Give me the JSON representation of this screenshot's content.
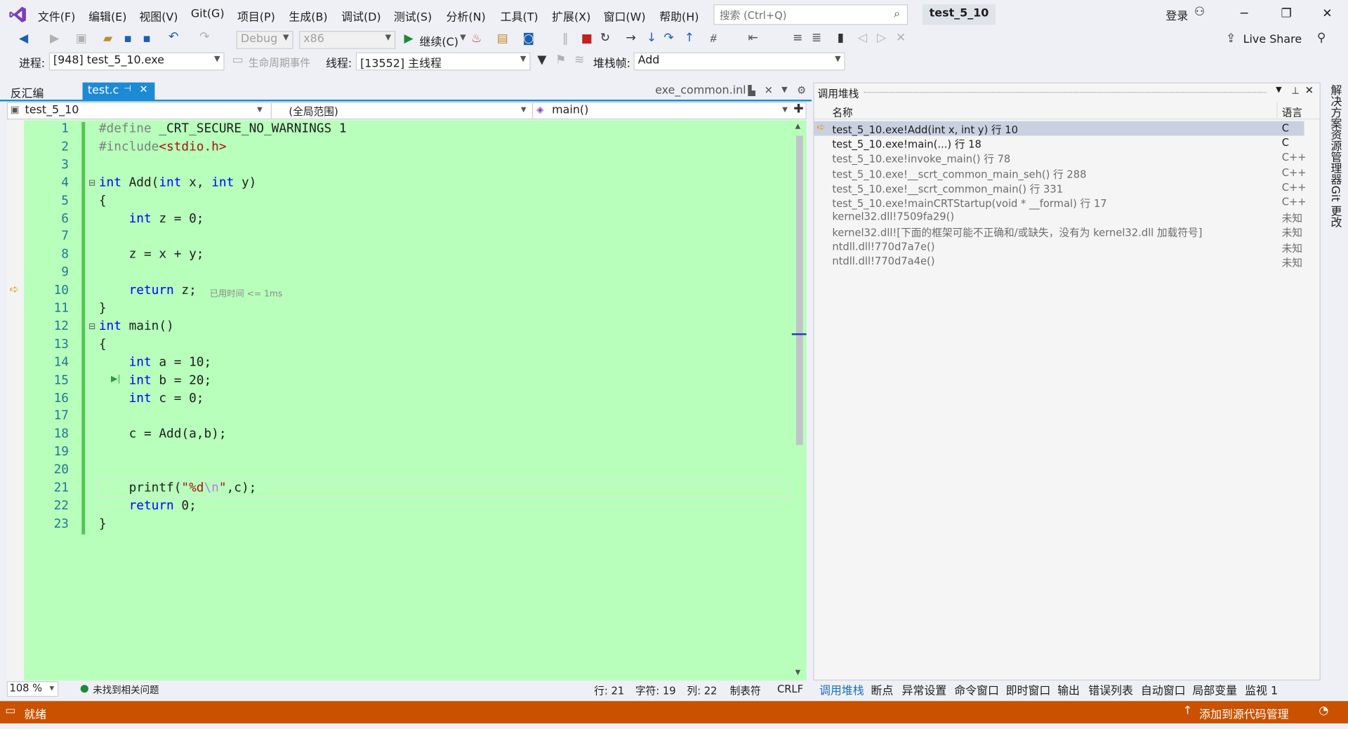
{
  "menu": [
    "文件(F)",
    "编辑(E)",
    "视图(V)",
    "Git(G)",
    "项目(P)",
    "生成(B)",
    "调试(D)",
    "测试(S)",
    "分析(N)",
    "工具(T)",
    "扩展(X)",
    "窗口(W)",
    "帮助(H)"
  ],
  "search_placeholder": "搜索 (Ctrl+Q)",
  "project_name": "test_5_10",
  "login": "登录",
  "live_share": "Live Share",
  "toolbar": {
    "config": "Debug",
    "platform": "x86",
    "continue": "继续(C)"
  },
  "debug_location": {
    "process_label": "进程:",
    "process_value": "[948] test_5_10.exe",
    "lifecycle": "生命周期事件",
    "thread_label": "线程:",
    "thread_value": "[13552] 主线程",
    "stackframe_label": "堆栈帧:",
    "stackframe_value": "Add"
  },
  "editor_tabs": {
    "disasm": "反汇编",
    "active": "test.c",
    "pinned": "exe_common.inl"
  },
  "nav": {
    "project": "test_5_10",
    "scope": "(全局范围)",
    "member": "main()"
  },
  "code_lines": [
    {
      "n": "1",
      "html": "<span class='pp'>#define</span> _CRT_SECURE_NO_WARNINGS 1"
    },
    {
      "n": "2",
      "html": "<span class='pp'>#include</span><span class='str'>&lt;stdio.h&gt;</span>"
    },
    {
      "n": "3",
      "html": ""
    },
    {
      "n": "4",
      "html": "<span class='kw'>int</span> Add(<span class='kw'>int</span> x, <span class='kw'>int</span> y)"
    },
    {
      "n": "5",
      "html": "{"
    },
    {
      "n": "6",
      "html": "    <span class='kw'>int</span> z = 0;"
    },
    {
      "n": "7",
      "html": ""
    },
    {
      "n": "8",
      "html": "    z = x + y;"
    },
    {
      "n": "9",
      "html": ""
    },
    {
      "n": "10",
      "html": "    <span class='kw'>return</span> z;"
    },
    {
      "n": "11",
      "html": "}"
    },
    {
      "n": "12",
      "html": "<span class='kw'>int</span> main()"
    },
    {
      "n": "13",
      "html": "{"
    },
    {
      "n": "14",
      "html": "    <span class='kw'>int</span> a = 10;"
    },
    {
      "n": "15",
      "html": "    <span class='kw'>int</span> b = 20;"
    },
    {
      "n": "16",
      "html": "    <span class='kw'>int</span> c = 0;"
    },
    {
      "n": "17",
      "html": ""
    },
    {
      "n": "18",
      "html": "    c = Add(a,b);"
    },
    {
      "n": "19",
      "html": ""
    },
    {
      "n": "20",
      "html": ""
    },
    {
      "n": "21",
      "html": "    printf(<span class='str'>\"%d<span class='esc'>\\n</span>\"</span>,c);"
    },
    {
      "n": "22",
      "html": "    <span class='kw'>return</span> 0;"
    },
    {
      "n": "23",
      "html": "}"
    }
  ],
  "elapsed_hint": "已用时间 <= 1ms",
  "callstack": {
    "title": "调用堆栈",
    "col_name": "名称",
    "col_lang": "语言",
    "rows": [
      {
        "name": "test_5_10.exe!Add(int x, int y) 行 10",
        "lang": "C"
      },
      {
        "name": "test_5_10.exe!main(...) 行 18",
        "lang": "C"
      },
      {
        "name": "test_5_10.exe!invoke_main() 行 78",
        "lang": "C++"
      },
      {
        "name": "test_5_10.exe!__scrt_common_main_seh() 行 288",
        "lang": "C++"
      },
      {
        "name": "test_5_10.exe!__scrt_common_main() 行 331",
        "lang": "C++"
      },
      {
        "name": "test_5_10.exe!mainCRTStartup(void * __formal) 行 17",
        "lang": "C++"
      },
      {
        "name": "kernel32.dll!7509fa29()",
        "lang": "未知"
      },
      {
        "name": "kernel32.dll![下面的框架可能不正确和/或缺失，没有为 kernel32.dll 加载符号]",
        "lang": "未知"
      },
      {
        "name": "ntdll.dll!770d7a7e()",
        "lang": "未知"
      },
      {
        "name": "ntdll.dll!770d7a4e()",
        "lang": "未知"
      }
    ]
  },
  "editor_status": {
    "zoom": "108 %",
    "issues": "未找到相关问题",
    "line": "行: 21",
    "char": "字符: 19",
    "col": "列: 22",
    "tabs": "制表符",
    "eol": "CRLF"
  },
  "bottom_tabs": [
    "调用堆栈",
    "断点",
    "异常设置",
    "命令窗口",
    "即时窗口",
    "输出",
    "错误列表",
    "自动窗口",
    "局部变量",
    "监视 1"
  ],
  "status": {
    "ready": "就绪",
    "source_control": "添加到源代码管理"
  },
  "side_tabs": [
    "解决方案资源管理器",
    "Git 更改"
  ],
  "colors": {
    "editor_bg": "#b7ffbb",
    "status_bg": "#ca5100",
    "accent": "#1c5fb0"
  }
}
